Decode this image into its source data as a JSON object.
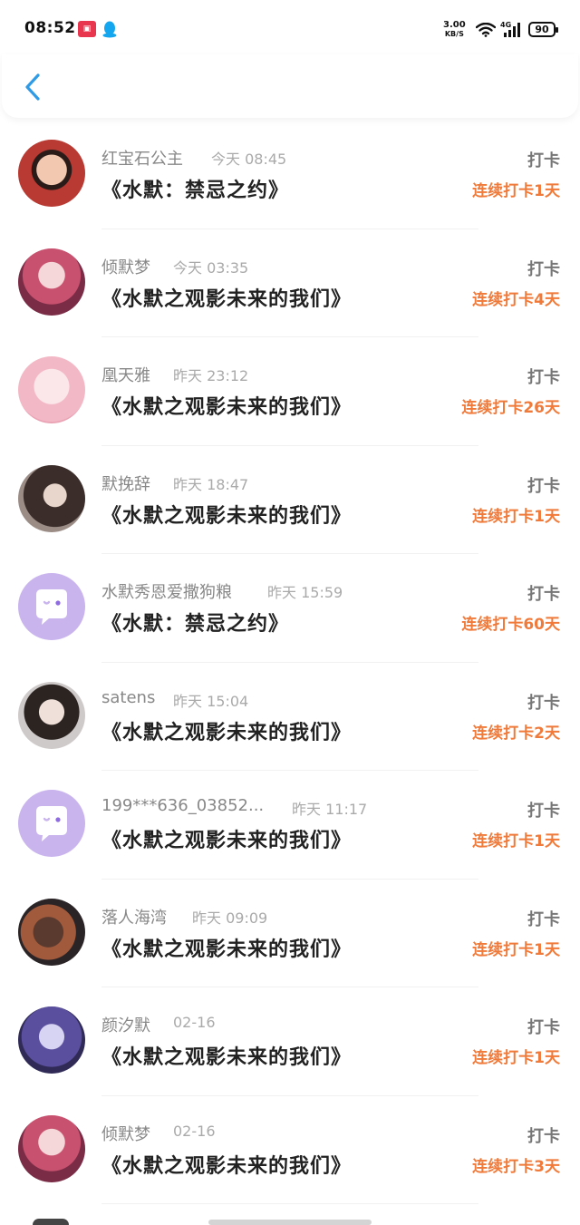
{
  "status_bar": {
    "time": "08:52",
    "net_speed": "3.00",
    "net_unit": "KB/S",
    "battery": "90"
  },
  "colors": {
    "accent": "#2f9be6",
    "streak": "#f07a3a",
    "placeholder_avatar": "#c9b4ee"
  },
  "entries": [
    {
      "name": "红宝石公主",
      "time": "今天 08:45",
      "book": "《水默：禁忌之约》",
      "action": "打卡",
      "streak": "连续打卡1天",
      "avatar": "photo"
    },
    {
      "name": "倾默梦",
      "time": "今天 03:35",
      "book": "《水默之观影未来的我们》",
      "action": "打卡",
      "streak": "连续打卡4天",
      "avatar": "photo"
    },
    {
      "name": "凰天雅",
      "time": "昨天 23:12",
      "book": "《水默之观影未来的我们》",
      "action": "打卡",
      "streak": "连续打卡26天",
      "avatar": "photo"
    },
    {
      "name": "默挽辞",
      "time": "昨天 18:47",
      "book": "《水默之观影未来的我们》",
      "action": "打卡",
      "streak": "连续打卡1天",
      "avatar": "photo"
    },
    {
      "name": "水默秀恩爱撒狗粮",
      "time": "昨天 15:59",
      "book": "《水默：禁忌之约》",
      "action": "打卡",
      "streak": "连续打卡60天",
      "avatar": "default"
    },
    {
      "name": "satens",
      "time": "昨天 15:04",
      "book": "《水默之观影未来的我们》",
      "action": "打卡",
      "streak": "连续打卡2天",
      "avatar": "photo"
    },
    {
      "name": "199***636_03852...",
      "time": "昨天 11:17",
      "book": "《水默之观影未来的我们》",
      "action": "打卡",
      "streak": "连续打卡1天",
      "avatar": "default"
    },
    {
      "name": "落人海湾",
      "time": "昨天 09:09",
      "book": "《水默之观影未来的我们》",
      "action": "打卡",
      "streak": "连续打卡1天",
      "avatar": "photo"
    },
    {
      "name": "颜汐默",
      "time": "02-16",
      "book": "《水默之观影未来的我们》",
      "action": "打卡",
      "streak": "连续打卡1天",
      "avatar": "photo"
    },
    {
      "name": "倾默梦",
      "time": "02-16",
      "book": "《水默之观影未来的我们》",
      "action": "打卡",
      "streak": "连续打卡3天",
      "avatar": "photo"
    }
  ]
}
